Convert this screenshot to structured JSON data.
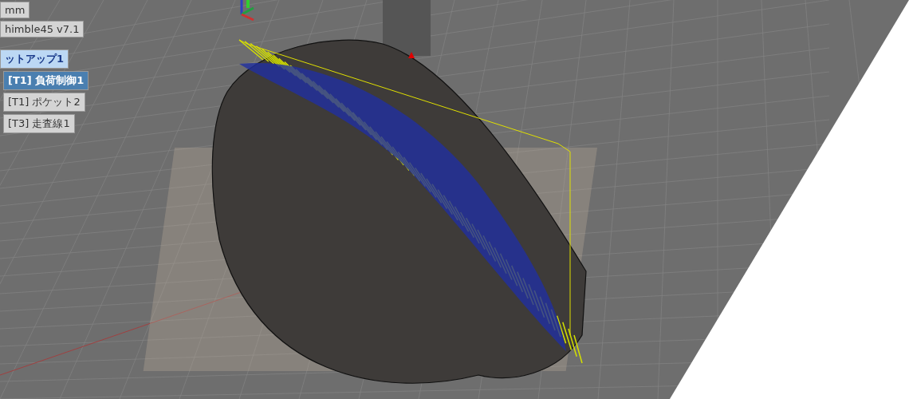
{
  "tree": {
    "items": [
      {
        "label": "mm",
        "kind": "node",
        "selected": false
      },
      {
        "label": "himble45 v7.1",
        "kind": "node",
        "selected": false
      },
      {
        "label": "ットアップ1",
        "kind": "setup",
        "selected": false
      },
      {
        "label": "[T1] 負荷制御1",
        "kind": "operation",
        "selected": true
      },
      {
        "label": "[T1] ポケット2",
        "kind": "operation",
        "selected": false
      },
      {
        "label": "[T3] 走査線1",
        "kind": "operation",
        "selected": false
      }
    ]
  }
}
